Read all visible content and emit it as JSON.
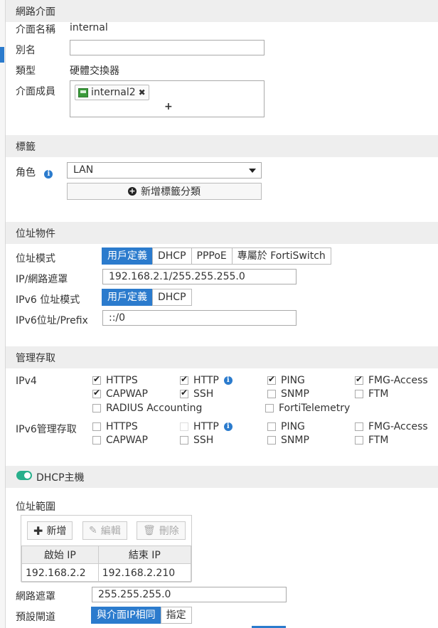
{
  "sections": {
    "interface": "網路介面",
    "tags": "標籤",
    "address": "位址物件",
    "admin": "管理存取",
    "dhcp": "DHCP主機"
  },
  "interface": {
    "name_label": "介面名稱",
    "name_value": "internal",
    "alias_label": "別名",
    "alias_value": "",
    "type_label": "類型",
    "type_value": "硬體交換器",
    "members_label": "介面成員",
    "member_chip": "internal2",
    "member_remove": "✖",
    "add_member": "+"
  },
  "tags": {
    "role_label": "角色",
    "role_value": "LAN",
    "add_tag_button": "新增標籤分類"
  },
  "address": {
    "mode_label": "位址模式",
    "modes": [
      "用戶定義",
      "DHCP",
      "PPPoE",
      "專屬於 FortiSwitch"
    ],
    "ip_label": "IP/網路遮罩",
    "ip_value": "192.168.2.1/255.255.255.0",
    "ipv6_mode_label": "IPv6 位址模式",
    "ipv6_modes": [
      "用戶定義",
      "DHCP"
    ],
    "ipv6_label": "IPv6位址/Prefix",
    "ipv6_value": "::/0"
  },
  "admin": {
    "ipv4_label": "IPv4",
    "ipv6_label": "IPv6管理存取",
    "ipv4": {
      "https": "HTTPS",
      "http": "HTTP",
      "ping": "PING",
      "fmg": "FMG-Access",
      "capwap": "CAPWAP",
      "ssh": "SSH",
      "snmp": "SNMP",
      "ftm": "FTM",
      "radius": "RADIUS Accounting",
      "telemetry": "FortiTelemetry"
    },
    "ipv6": {
      "https": "HTTPS",
      "http": "HTTP",
      "ping": "PING",
      "fmg": "FMG-Access",
      "capwap": "CAPWAP",
      "ssh": "SSH",
      "snmp": "SNMP",
      "ftm": "FTM"
    }
  },
  "dhcp": {
    "range_label": "位址範圍",
    "toolbar": {
      "new": "新增",
      "edit": "編輯",
      "delete": "刪除"
    },
    "columns": [
      "啟始 IP",
      "結束 IP"
    ],
    "rows": [
      {
        "start": "192.168.2.2",
        "end": "192.168.2.210"
      }
    ],
    "netmask_label": "網路遮罩",
    "netmask_value": "255.255.255.0",
    "gateway_label": "預設閘道",
    "gateway_modes": [
      "與介面IP相同",
      "指定"
    ]
  },
  "colors": {
    "accent": "#2b7bcd",
    "toggle_on": "#28b08c"
  }
}
